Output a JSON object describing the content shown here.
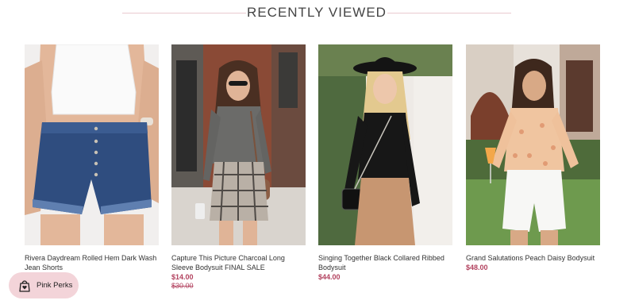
{
  "section": {
    "title": "RECENTLY VIEWED"
  },
  "products": [
    {
      "name": "Rivera Daydream Rolled Hem Dark Wash Jean Shorts",
      "price": "",
      "compare_price": ""
    },
    {
      "name": "Capture This Picture Charcoal Long Sleeve Bodysuit FINAL SALE",
      "price": "$14.00",
      "compare_price": "$30.00"
    },
    {
      "name": "Singing Together Black Collared Ribbed Bodysuit",
      "price": "$44.00",
      "compare_price": ""
    },
    {
      "name": "Grand Salutations Peach Daisy Bodysuit",
      "price": "$48.00",
      "compare_price": ""
    }
  ],
  "perks_button": {
    "label": "Pink Perks",
    "icon": "shopping-bag-heart-icon"
  },
  "colors": {
    "price": "#b2415e",
    "accent_pink": "#f3d4d9",
    "divider": "#e9c9d0"
  }
}
